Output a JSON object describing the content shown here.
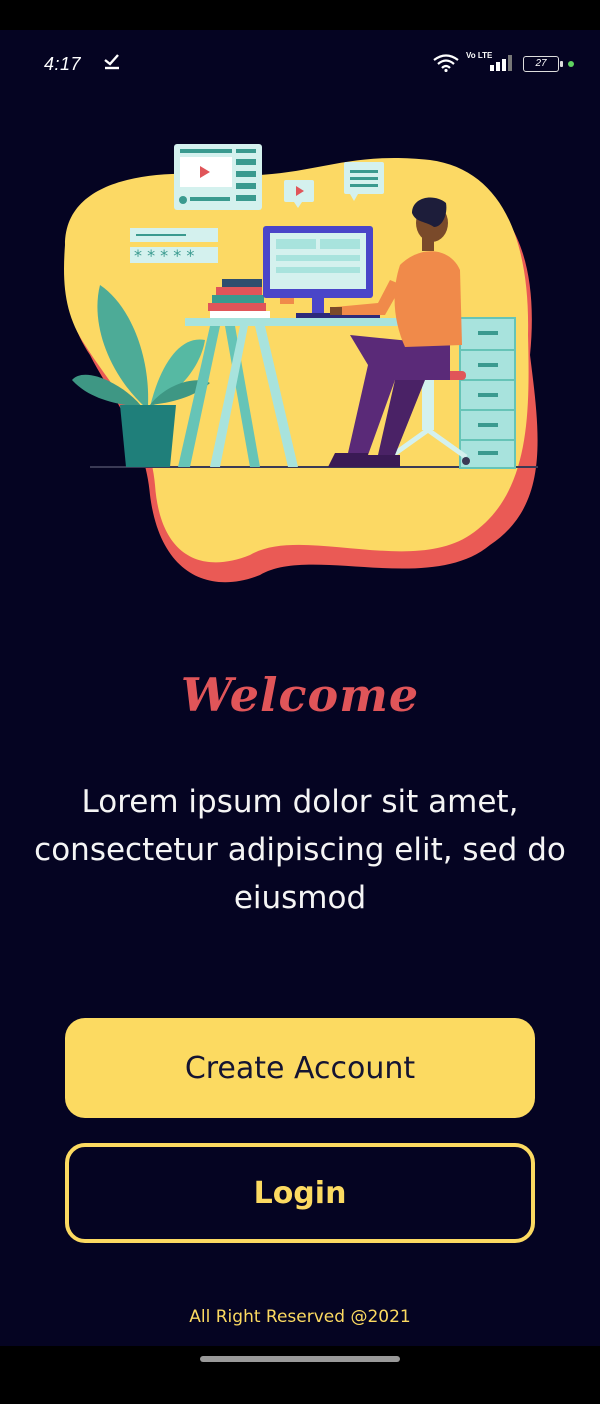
{
  "status": {
    "time": "4:17",
    "network": "Vo LTE",
    "battery": "27"
  },
  "welcome": {
    "title": "Welcome",
    "description": "Lorem ipsum dolor sit amet, consectetur adipiscing elit, sed do eiusmod"
  },
  "buttons": {
    "create_account": "Create Account",
    "login": "Login"
  },
  "footer": {
    "text": "All Right Reserved @2021"
  },
  "colors": {
    "background": "#050422",
    "accent_yellow": "#fcda61",
    "accent_red": "#e05559"
  }
}
